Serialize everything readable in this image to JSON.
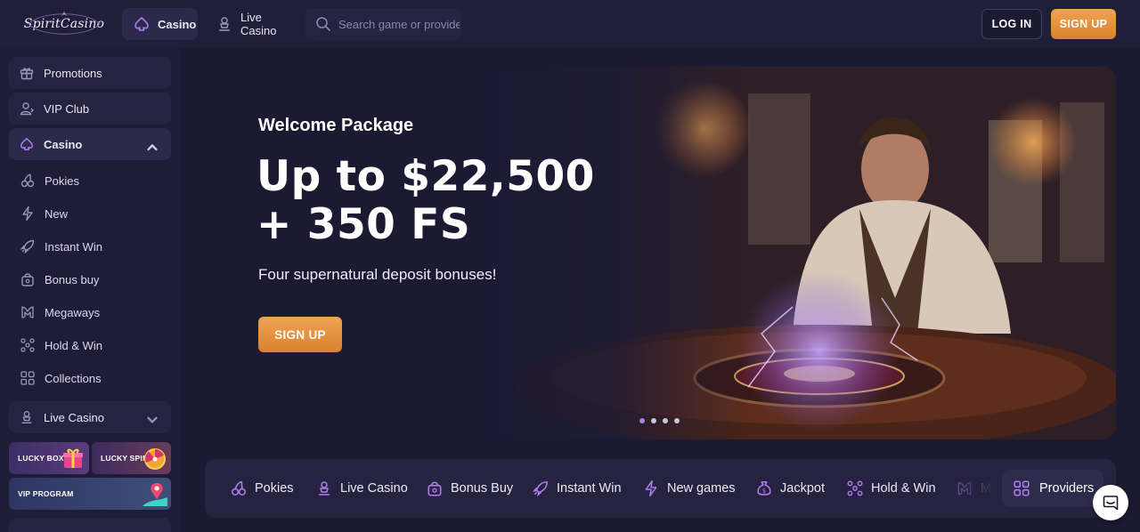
{
  "brand": {
    "logo_text": "SpiritCasino"
  },
  "header": {
    "nav": [
      {
        "label": "Casino",
        "icon": "spade-icon",
        "active": true
      },
      {
        "label": "Live Casino",
        "icon": "dealer-icon",
        "active": false
      }
    ],
    "search": {
      "placeholder": "Search game or provider"
    },
    "login_label": "LOG IN",
    "signup_label": "SIGN UP"
  },
  "sidebar": {
    "items": [
      {
        "label": "Promotions",
        "icon": "gift-icon"
      },
      {
        "label": "VIP Club",
        "icon": "user-badge-icon"
      },
      {
        "label": "Casino",
        "icon": "spade-icon",
        "expanded": true
      }
    ],
    "casino_sub": [
      {
        "label": "Pokies",
        "icon": "cherries-icon"
      },
      {
        "label": "New",
        "icon": "lightning-icon"
      },
      {
        "label": "Instant Win",
        "icon": "rocket-icon"
      },
      {
        "label": "Bonus buy",
        "icon": "bag-icon"
      },
      {
        "label": "Megaways",
        "icon": "megaways-icon"
      },
      {
        "label": "Hold & Win",
        "icon": "dots-grid-icon"
      },
      {
        "label": "Collections",
        "icon": "collections-icon"
      }
    ],
    "live_casino": {
      "label": "Live Casino",
      "icon": "dealer-icon",
      "expanded": false
    },
    "promo_cards": [
      {
        "label": "LUCKY BOX",
        "icon": "gift-box-icon"
      },
      {
        "label": "LUCKY SPIN",
        "icon": "wheel-icon"
      },
      {
        "label": "VIP PROGRAM",
        "icon": "map-pin-icon"
      }
    ]
  },
  "banner": {
    "eyebrow": "Welcome Package",
    "title_line1": "Up to $22,500",
    "title_line2": "+ 350 FS",
    "subtitle": "Four supernatural deposit bonuses!",
    "cta_label": "SIGN UP",
    "slides_total": 4,
    "active_slide": 1
  },
  "categories": [
    {
      "label": "Pokies",
      "icon": "cherries-icon"
    },
    {
      "label": "Live Casino",
      "icon": "dealer-icon"
    },
    {
      "label": "Bonus Buy",
      "icon": "bag-icon"
    },
    {
      "label": "Instant Win",
      "icon": "rocket-icon"
    },
    {
      "label": "New games",
      "icon": "lightning-icon"
    },
    {
      "label": "Jackpot",
      "icon": "money-bag-icon"
    },
    {
      "label": "Hold & Win",
      "icon": "dots-grid-icon"
    },
    {
      "label": "M",
      "icon": "megaways-icon"
    }
  ],
  "providers_label": "Providers",
  "colors": {
    "accent": "#b07cf0",
    "cta_orange": "#e8913c",
    "background": "#1c1a33",
    "panel": "#25233f"
  }
}
